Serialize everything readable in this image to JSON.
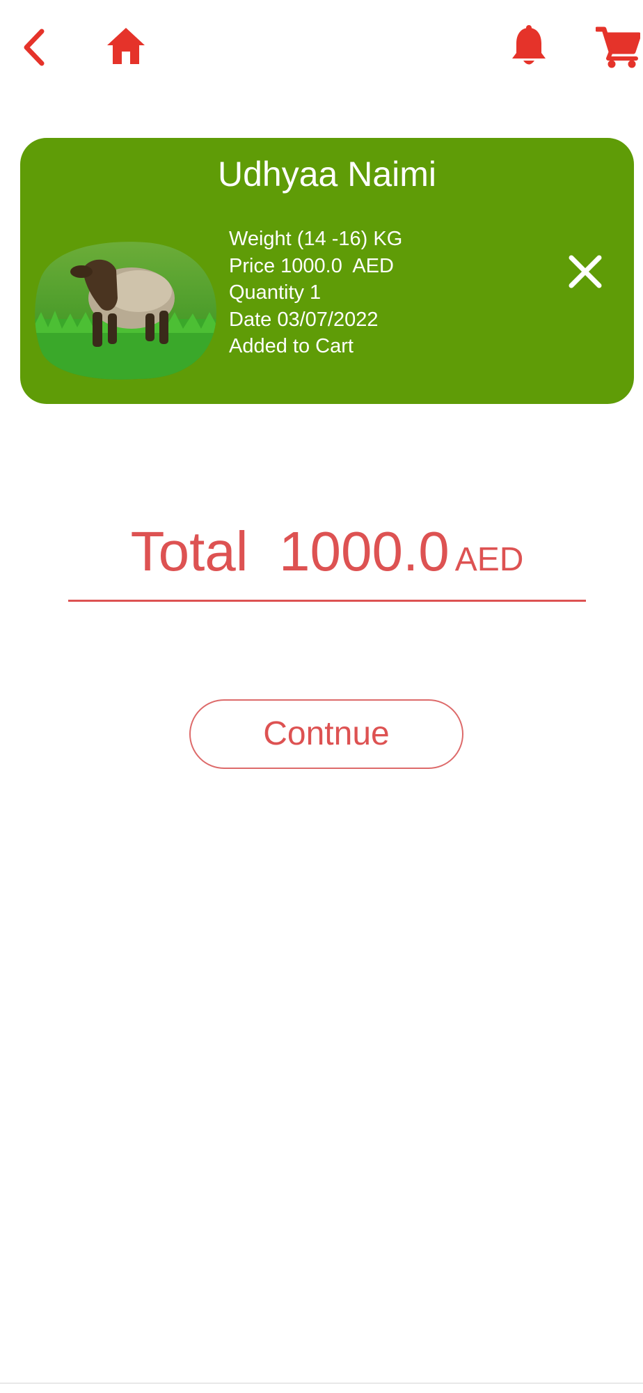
{
  "toolbar": {
    "icons": [
      "back-icon",
      "home-icon",
      "notifications-icon",
      "cart-icon"
    ],
    "accent_color": "#e5332a"
  },
  "cart_item": {
    "title": "Udhyaa Naimi",
    "weight": "Weight (14 -16) KG",
    "price": "Price 1000.0  AED",
    "quantity": "Quantity 1",
    "date": "Date 03/07/2022",
    "status": "Added to Cart",
    "card_color": "#5f9c07",
    "remove_icon": "close-icon"
  },
  "summary": {
    "total_label": "Total  1000.0",
    "currency": "AED",
    "text_color": "#dd5252"
  },
  "actions": {
    "continue_label": "Contnue"
  }
}
